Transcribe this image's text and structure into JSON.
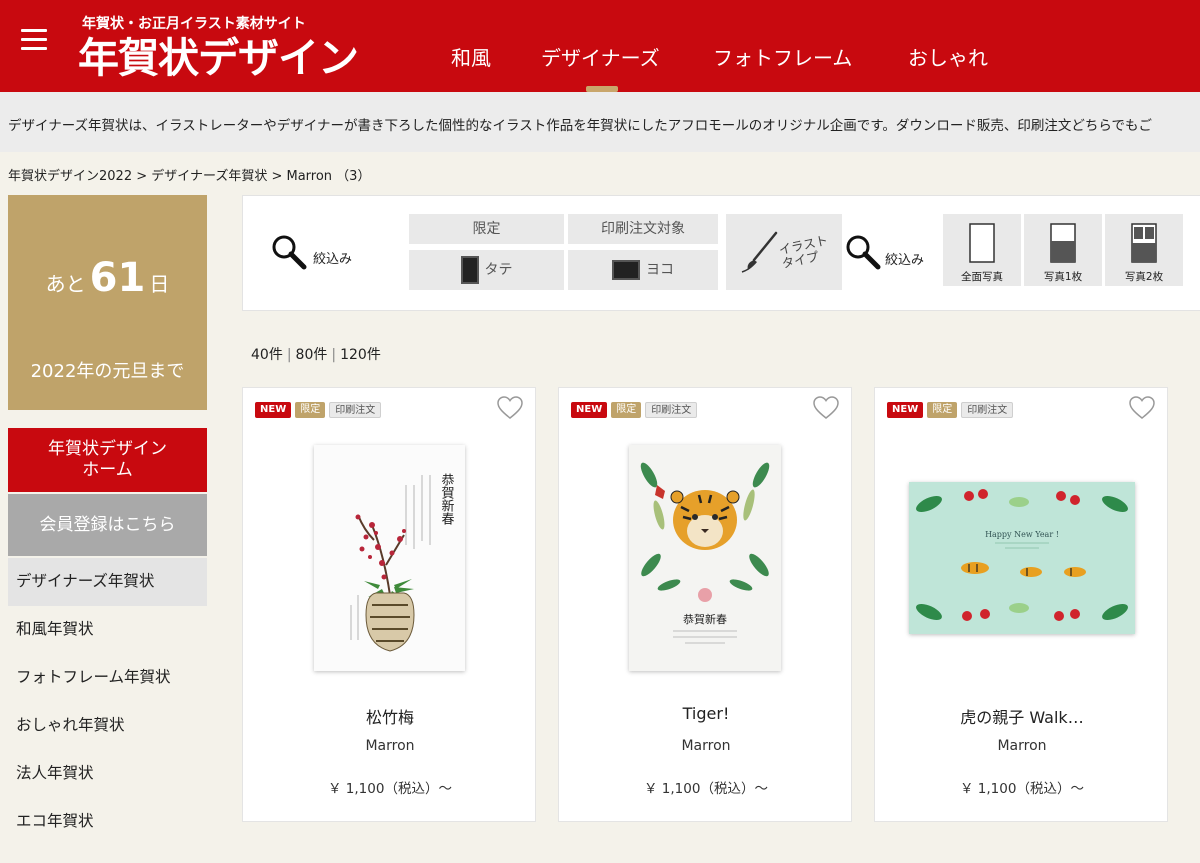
{
  "header": {
    "tagline": "年賀状・お正月イラスト素材サイト",
    "logo": "年賀状デザイン",
    "nav": [
      {
        "label": "和風"
      },
      {
        "label": "デザイナーズ",
        "active": true
      },
      {
        "label": "フォトフレーム"
      },
      {
        "label": "おしゃれ"
      }
    ],
    "accent_color": "#c8090f"
  },
  "intro": {
    "text": "デザイナーズ年賀状は、イラストレーターやデザイナーが書き下ろした個性的なイラスト作品を年賀状にしたアフロモールのオリジナル企画です。ダウンロード販売、印刷注文どちらでもご"
  },
  "breadcrumb": "年賀状デザイン2022 > デザイナーズ年賀状 > Marron （3）",
  "countdown": {
    "prefix": "あと",
    "days": "61",
    "suffix": "日",
    "caption": "2022年の元旦まで"
  },
  "sidebar": {
    "home_label": "年賀状デザイン ホーム",
    "register_label": "会員登録はこちら",
    "items": [
      {
        "label": "デザイナーズ年賀状",
        "active": true
      },
      {
        "label": "和風年賀状"
      },
      {
        "label": "フォトフレーム年賀状"
      },
      {
        "label": "おしゃれ年賀状"
      },
      {
        "label": "法人年賀状"
      },
      {
        "label": "エコ年賀状"
      }
    ]
  },
  "filters": {
    "search_label_1": "絞込み",
    "limited": "限定",
    "print_target": "印刷注文対象",
    "portrait": "タテ",
    "landscape": "ヨコ",
    "illust_type": "イラスト タイプ",
    "search_label_2": "絞込み",
    "photo_options": [
      {
        "label": "全面写真",
        "icon": "full-photo-icon"
      },
      {
        "label": "写真1枚",
        "icon": "one-photo-icon"
      },
      {
        "label": "写真2枚",
        "icon": "two-photo-icon"
      }
    ]
  },
  "per_page": [
    "40件",
    "80件",
    "120件"
  ],
  "products": [
    {
      "badges": [
        "NEW",
        "限定",
        "印刷注文"
      ],
      "title": "松竹梅",
      "author": "Marron",
      "price": "￥ 1,100（税込）～",
      "image": "plum-vase-card"
    },
    {
      "badges": [
        "NEW",
        "限定",
        "印刷注文"
      ],
      "title": "Tiger!",
      "author": "Marron",
      "price": "￥ 1,100（税込）～",
      "image": "tiger-wreath-card"
    },
    {
      "badges": [
        "NEW",
        "限定",
        "印刷注文"
      ],
      "title": "虎の親子 Walk…",
      "author": "Marron",
      "price": "￥ 1,100（税込）～",
      "image": "tiger-family-walk-card",
      "card_text": "Happy New Year !"
    }
  ],
  "card1_text": "恭賀新春",
  "card2_text": "恭賀新春"
}
